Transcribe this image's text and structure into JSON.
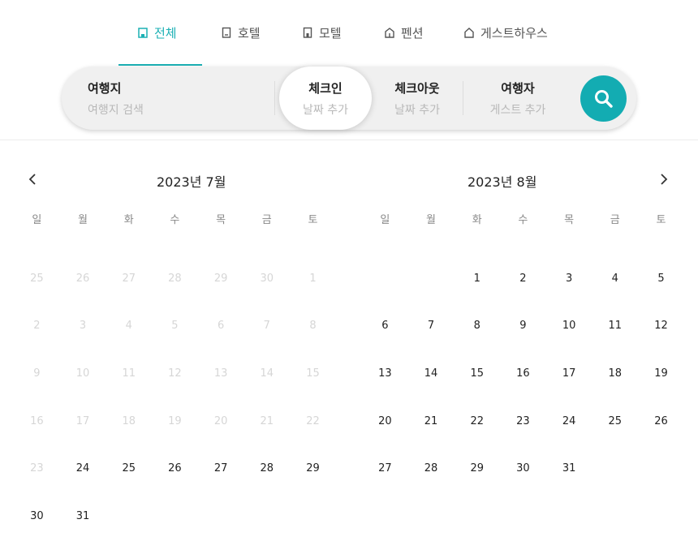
{
  "tabs": [
    {
      "label": "전체",
      "icon": "building-icon",
      "active": true
    },
    {
      "label": "호텔",
      "icon": "hotel-icon",
      "active": false
    },
    {
      "label": "모텔",
      "icon": "motel-icon",
      "active": false
    },
    {
      "label": "펜션",
      "icon": "pension-icon",
      "active": false
    },
    {
      "label": "게스트하우스",
      "icon": "house-icon",
      "active": false
    }
  ],
  "search": {
    "destination": {
      "label": "여행지",
      "placeholder": "여행지 검색"
    },
    "checkin": {
      "label": "체크인",
      "placeholder": "날짜 추가"
    },
    "checkout": {
      "label": "체크아웃",
      "placeholder": "날짜 추가"
    },
    "guests": {
      "label": "여행자",
      "placeholder": "게스트 추가"
    },
    "button_icon": "search-icon"
  },
  "calendar": {
    "weekdays": [
      "일",
      "월",
      "화",
      "수",
      "목",
      "금",
      "토"
    ],
    "months": [
      {
        "title": "2023년 7월",
        "weeks": [
          [
            {
              "d": "25",
              "f": true
            },
            {
              "d": "26",
              "f": true
            },
            {
              "d": "27",
              "f": true
            },
            {
              "d": "28",
              "f": true
            },
            {
              "d": "29",
              "f": true
            },
            {
              "d": "30",
              "f": true
            },
            {
              "d": "1",
              "f": true
            }
          ],
          [
            {
              "d": "2",
              "f": true
            },
            {
              "d": "3",
              "f": true
            },
            {
              "d": "4",
              "f": true
            },
            {
              "d": "5",
              "f": true
            },
            {
              "d": "6",
              "f": true
            },
            {
              "d": "7",
              "f": true
            },
            {
              "d": "8",
              "f": true
            }
          ],
          [
            {
              "d": "9",
              "f": true
            },
            {
              "d": "10",
              "f": true
            },
            {
              "d": "11",
              "f": true
            },
            {
              "d": "12",
              "f": true
            },
            {
              "d": "13",
              "f": true
            },
            {
              "d": "14",
              "f": true
            },
            {
              "d": "15",
              "f": true
            }
          ],
          [
            {
              "d": "16",
              "f": true
            },
            {
              "d": "17",
              "f": true
            },
            {
              "d": "18",
              "f": true
            },
            {
              "d": "19",
              "f": true
            },
            {
              "d": "20",
              "f": true
            },
            {
              "d": "21",
              "f": true
            },
            {
              "d": "22",
              "f": true
            }
          ],
          [
            {
              "d": "23",
              "f": true
            },
            {
              "d": "24",
              "f": false
            },
            {
              "d": "25",
              "f": false
            },
            {
              "d": "26",
              "f": false
            },
            {
              "d": "27",
              "f": false
            },
            {
              "d": "28",
              "f": false
            },
            {
              "d": "29",
              "f": false
            }
          ],
          [
            {
              "d": "30",
              "f": false
            },
            {
              "d": "31",
              "f": false
            },
            {
              "d": "",
              "f": false
            },
            {
              "d": "",
              "f": false
            },
            {
              "d": "",
              "f": false
            },
            {
              "d": "",
              "f": false
            },
            {
              "d": "",
              "f": false
            }
          ]
        ]
      },
      {
        "title": "2023년 8월",
        "weeks": [
          [
            {
              "d": "",
              "f": false
            },
            {
              "d": "",
              "f": false
            },
            {
              "d": "1",
              "f": false
            },
            {
              "d": "2",
              "f": false
            },
            {
              "d": "3",
              "f": false
            },
            {
              "d": "4",
              "f": false
            },
            {
              "d": "5",
              "f": false
            }
          ],
          [
            {
              "d": "6",
              "f": false
            },
            {
              "d": "7",
              "f": false
            },
            {
              "d": "8",
              "f": false
            },
            {
              "d": "9",
              "f": false
            },
            {
              "d": "10",
              "f": false
            },
            {
              "d": "11",
              "f": false
            },
            {
              "d": "12",
              "f": false
            }
          ],
          [
            {
              "d": "13",
              "f": false
            },
            {
              "d": "14",
              "f": false
            },
            {
              "d": "15",
              "f": false
            },
            {
              "d": "16",
              "f": false
            },
            {
              "d": "17",
              "f": false
            },
            {
              "d": "18",
              "f": false
            },
            {
              "d": "19",
              "f": false
            }
          ],
          [
            {
              "d": "20",
              "f": false
            },
            {
              "d": "21",
              "f": false
            },
            {
              "d": "22",
              "f": false
            },
            {
              "d": "23",
              "f": false
            },
            {
              "d": "24",
              "f": false
            },
            {
              "d": "25",
              "f": false
            },
            {
              "d": "26",
              "f": false
            }
          ],
          [
            {
              "d": "27",
              "f": false
            },
            {
              "d": "28",
              "f": false
            },
            {
              "d": "29",
              "f": false
            },
            {
              "d": "30",
              "f": false
            },
            {
              "d": "31",
              "f": false
            },
            {
              "d": "",
              "f": false
            },
            {
              "d": "",
              "f": false
            }
          ]
        ]
      }
    ],
    "prev_icon": "chevron-left-icon",
    "next_icon": "chevron-right-icon"
  },
  "colors": {
    "accent": "#1bb0b4",
    "search_button": "#13acb2",
    "faded_day": "#d6d6d6"
  }
}
